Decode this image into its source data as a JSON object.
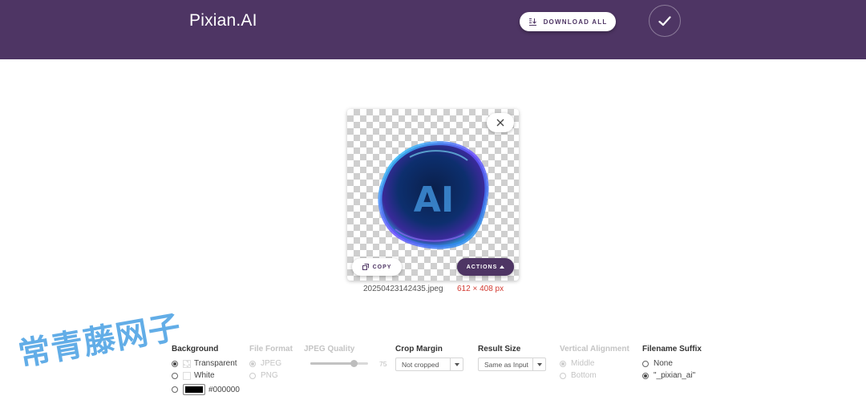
{
  "app": {
    "brand": "Pixian.AI",
    "download_all_label": "DOWNLOAD ALL",
    "accent_color": "#4e3564"
  },
  "image_card": {
    "copy_label": "COPY",
    "actions_label": "ACTIONS",
    "overlay_text": "AI",
    "filename": "20250423142435.jpeg",
    "dimensions": "612 × 408 px"
  },
  "options": {
    "background": {
      "title": "Background",
      "choices": [
        {
          "label": "Transparent",
          "selected": true
        },
        {
          "label": "White",
          "selected": false
        },
        {
          "label": "#000000",
          "selected": false
        }
      ],
      "color_value": "#000000"
    },
    "file_format": {
      "title": "File Format",
      "enabled": false,
      "choices": [
        {
          "label": "JPEG",
          "selected": true
        },
        {
          "label": "PNG",
          "selected": false
        }
      ]
    },
    "jpeg_quality": {
      "title": "JPEG Quality",
      "enabled": false,
      "value": 75,
      "value_label": "75"
    },
    "crop_margin": {
      "title": "Crop Margin",
      "value": "Not cropped"
    },
    "result_size": {
      "title": "Result Size",
      "value": "Same as Input"
    },
    "vertical_alignment": {
      "title": "Vertical Alignment",
      "enabled": false,
      "choices": [
        {
          "label": "Middle",
          "selected": true
        },
        {
          "label": "Bottom",
          "selected": false
        }
      ]
    },
    "filename_suffix": {
      "title": "Filename Suffix",
      "choices": [
        {
          "label": "None",
          "selected": false
        },
        {
          "label": "\"_pixian_ai\"",
          "selected": true
        }
      ]
    }
  },
  "watermark_text": "常青藤网子"
}
